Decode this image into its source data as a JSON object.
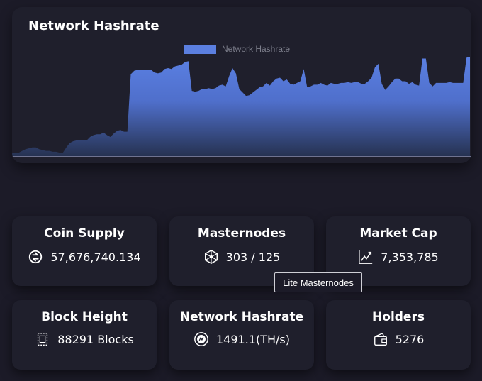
{
  "chart": {
    "title": "Network Hashrate",
    "legend_label": "Network Hashrate",
    "color": "#5b7fe0"
  },
  "chart_data": {
    "type": "area",
    "title": "Network Hashrate",
    "xlabel": "",
    "ylabel": "",
    "legend_position": "top-center",
    "grid": false,
    "ylim": [
      0,
      110
    ],
    "series": [
      {
        "name": "Network Hashrate",
        "values": [
          3,
          4,
          4,
          6,
          8,
          9,
          10,
          10,
          8,
          7,
          6,
          6,
          5,
          5,
          4,
          4,
          10,
          15,
          17,
          18,
          18,
          18,
          18,
          22,
          24,
          25,
          25,
          27,
          24,
          22,
          26,
          29,
          30,
          28,
          28,
          94,
          98,
          99,
          99,
          99,
          99,
          99,
          96,
          95,
          96,
          100,
          101,
          100,
          103,
          104,
          105,
          108,
          109,
          75,
          74,
          75,
          77,
          77,
          78,
          77,
          78,
          81,
          82,
          80,
          92,
          101,
          95,
          77,
          73,
          69,
          70,
          73,
          76,
          79,
          80,
          84,
          81,
          86,
          89,
          90,
          86,
          88,
          83,
          82,
          84,
          86,
          100,
          79,
          80,
          82,
          82,
          84,
          82,
          81,
          84,
          83,
          83,
          84,
          84,
          85,
          84,
          85,
          85,
          83,
          83,
          86,
          90,
          102,
          106,
          83,
          76,
          80,
          85,
          89,
          89,
          86,
          86,
          83,
          85,
          82,
          81,
          112,
          112,
          84,
          80,
          84,
          84,
          84,
          84,
          85,
          84,
          84,
          84,
          84,
          113,
          114
        ]
      }
    ]
  },
  "stats": [
    {
      "title": "Coin Supply",
      "value": "57,676,740.134",
      "icon": "coin-supply-icon"
    },
    {
      "title": "Masternodes",
      "value": "303 / 125",
      "icon": "masternodes-icon"
    },
    {
      "title": "Market Cap",
      "value": "7,353,785",
      "icon": "market-cap-icon"
    },
    {
      "title": "Block Height",
      "value": "88291 Blocks",
      "icon": "block-height-icon"
    },
    {
      "title": "Network Hashrate",
      "value": "1491.1(TH/s)",
      "icon": "hashrate-icon"
    },
    {
      "title": "Holders",
      "value": "5276",
      "icon": "holders-icon"
    }
  ],
  "tooltip": {
    "text": "Lite Masternodes"
  }
}
